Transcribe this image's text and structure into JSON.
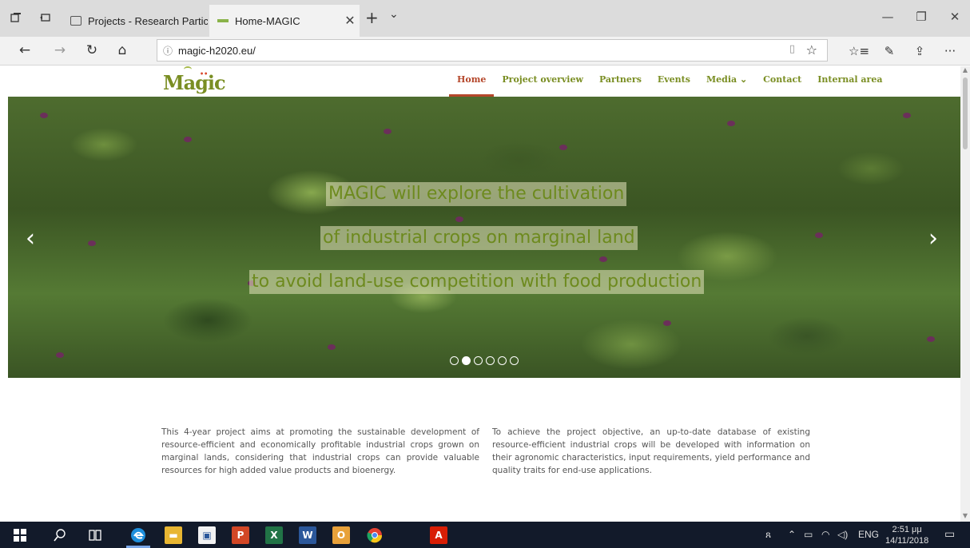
{
  "browser": {
    "tabs": [
      {
        "label": "Projects - Research Participa",
        "active": false
      },
      {
        "label": "Home-MAGIC",
        "active": true
      }
    ],
    "address": "magic-h2020.eu/",
    "icons": {
      "set_aside": "set-aside-tabs-icon",
      "show_aside": "tabs-aside-icon",
      "new_tab": "+",
      "tab_list": "⌄",
      "back": "←",
      "forward": "→",
      "refresh": "↻",
      "home": "⌂",
      "info": "ⓘ",
      "reading": "▯",
      "favorite": "☆",
      "favorites_hub": "☆≡",
      "notes": "✎",
      "share": "⇪",
      "more": "···",
      "minimize": "—",
      "restore": "❐",
      "close": "✕"
    }
  },
  "site": {
    "logo": "Magic",
    "nav": [
      {
        "label": "Home",
        "active": true
      },
      {
        "label": "Project overview",
        "active": false
      },
      {
        "label": "Partners",
        "active": false
      },
      {
        "label": "Events",
        "active": false
      },
      {
        "label": "Media ⌄",
        "active": false
      },
      {
        "label": "Contact",
        "active": false
      },
      {
        "label": "Internal area",
        "active": false
      }
    ],
    "carousel": {
      "lines": [
        "MAGIC will explore the cultivation",
        "of industrial crops on marginal land",
        "to avoid land-use competition with food production"
      ],
      "prev": "‹",
      "next": "›",
      "slide_count": 6,
      "active_slide": 2
    },
    "intro": [
      "This 4-year project aims at promoting the sustainable development of resource-efficient and economically profitable industrial crops grown on marginal lands, considering that industrial crops can provide valuable resources for high added value products and bioenergy.",
      "To achieve the project objective, an up-to-date database of existing resource-efficient industrial crops will be developed with information on their agronomic characteristics, input requirements, yield performance and quality traits for end-use applications."
    ]
  },
  "taskbar": {
    "language": "ENG",
    "time": "2:51 μμ",
    "date": "14/11/2018",
    "colors": {
      "background": "#121a2a",
      "edge": "#1e8fdc",
      "explorer": "#e8b632",
      "store": "#f2f2f2",
      "powerpoint": "#d24726",
      "excel": "#217346",
      "word": "#2b579a",
      "outlook": "#e8a13a",
      "chrome": "#e34133",
      "acrobat": "#d81e05"
    }
  },
  "colors": {
    "logo": "#7a8e23",
    "nav_text": "#7a8e23",
    "nav_active": "#b5472b",
    "slide_text": "#6d8a1e"
  }
}
